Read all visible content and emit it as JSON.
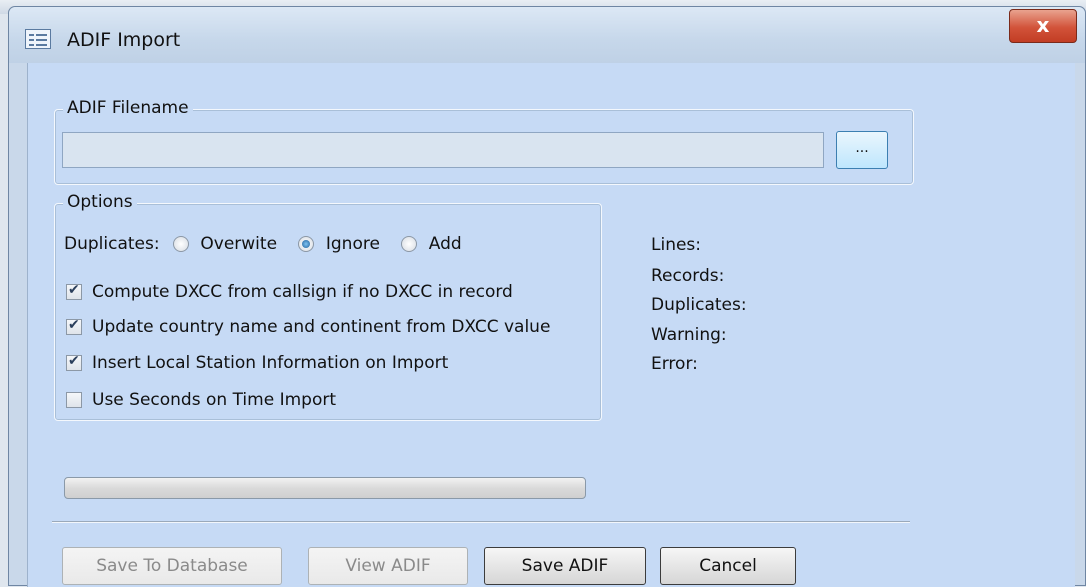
{
  "window": {
    "title": "ADIF Import",
    "close_label": "x"
  },
  "filename_group": {
    "label": "ADIF Filename",
    "input_value": "",
    "browse_label": "..."
  },
  "options_group": {
    "label": "Options",
    "duplicates_label": "Duplicates:",
    "radios": [
      {
        "label": "Overwite",
        "selected": false
      },
      {
        "label": "Ignore",
        "selected": true
      },
      {
        "label": "Add",
        "selected": false
      }
    ],
    "checkboxes": [
      {
        "label": "Compute DXCC from callsign if no DXCC in record",
        "checked": true
      },
      {
        "label": "Update country name and continent from DXCC value",
        "checked": true
      },
      {
        "label": "Insert Local Station Information on Import",
        "checked": true
      },
      {
        "label": "Use Seconds on Time Import",
        "checked": false
      }
    ]
  },
  "stats": {
    "lines": "Lines:",
    "records": "Records:",
    "duplicates": "Duplicates:",
    "warning": "Warning:",
    "error": "Error:"
  },
  "progress": {
    "value": 0
  },
  "buttons": {
    "save_to_database": "Save To Database",
    "view_adif": "View ADIF",
    "save_adif": "Save ADIF",
    "cancel": "Cancel"
  }
}
